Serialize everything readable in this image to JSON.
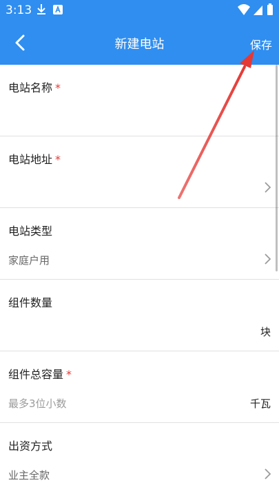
{
  "status_bar": {
    "time": "3:13",
    "icons": [
      "download-icon",
      "a-icon",
      "wifi-icon",
      "signal-icon",
      "battery-icon"
    ]
  },
  "app_bar": {
    "title": "新建电站",
    "save_label": "保存",
    "back_icon": "back-icon",
    "background_color": "#2f8ef0"
  },
  "form": {
    "rows": [
      {
        "label": "电站名称",
        "required": true,
        "value": "",
        "unit": ""
      },
      {
        "label": "电站地址",
        "required": true,
        "value": "",
        "unit": ""
      },
      {
        "label": "电站类型",
        "required": false,
        "value": "家庭户用",
        "unit": ""
      },
      {
        "label": "组件数量",
        "required": false,
        "value": "",
        "unit": "块"
      },
      {
        "label": "组件总容量",
        "required": true,
        "value": "最多3位小数",
        "unit": "千瓦"
      },
      {
        "label": "出资方式",
        "required": false,
        "value": "业主全款",
        "unit": ""
      }
    ],
    "required_mark": "*",
    "required_color": "#e53935"
  },
  "annotation": {
    "arrow_color": "#e53935"
  }
}
